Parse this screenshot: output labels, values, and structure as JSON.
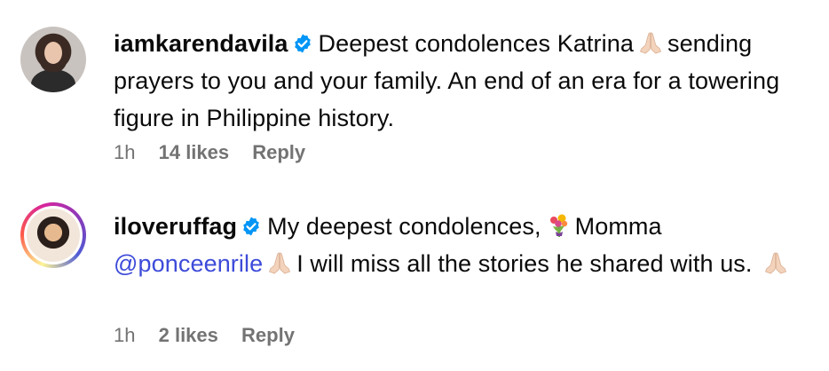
{
  "comments": [
    {
      "username": "iamkarendavila",
      "verified": true,
      "text_a": "Deepest condolences Katrina",
      "text_b": "sending prayers to you and your family. An end of an era for a towering figure in Philippine history.",
      "time": "1h",
      "likes": "14 likes",
      "reply": "Reply"
    },
    {
      "username": "iloveruffag",
      "verified": true,
      "text_a": "My deepest condolences,",
      "text_b": "Momma",
      "mention": "@ponceenrile",
      "text_c": "I will miss all the stories he shared with us.",
      "time": "1h",
      "likes": "2 likes",
      "reply": "Reply"
    }
  ],
  "icons": {
    "verified": "verified-badge-icon",
    "pray": "folded-hands-emoji",
    "flowers": "bouquet-emoji"
  },
  "colors": {
    "verified_blue": "#0095f6",
    "mention": "#3d4bd9",
    "meta_gray": "#737373"
  }
}
